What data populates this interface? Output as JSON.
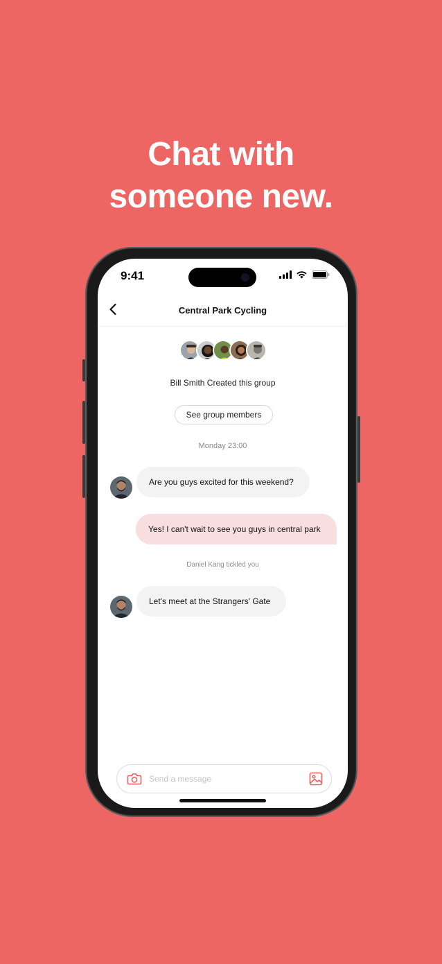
{
  "promo": {
    "headline_line1": "Chat with",
    "headline_line2": "someone new."
  },
  "status_bar": {
    "time": "9:41"
  },
  "nav": {
    "title": "Central Park Cycling"
  },
  "group": {
    "created_text": "Bill Smith Created this group",
    "members_button": "See group members",
    "member_avatars": [
      "avatar-1",
      "avatar-2",
      "avatar-3",
      "avatar-4",
      "avatar-5"
    ]
  },
  "chat": {
    "day_label": "Monday 23:00",
    "messages": [
      {
        "direction": "incoming",
        "text": "Are you guys excited for this weekend?"
      },
      {
        "direction": "outgoing",
        "text": "Yes! I can't wait to see you guys in central park"
      }
    ],
    "system_note": "Daniel Kang tickled you",
    "messages_after": [
      {
        "direction": "incoming",
        "text": "Let's meet at the Strangers' Gate"
      }
    ]
  },
  "composer": {
    "placeholder": "Send a message"
  },
  "colors": {
    "background": "#EE6663",
    "accent": "#E85F5C",
    "outgoing_bubble": "#F8DEDE",
    "incoming_bubble": "#F3F3F3"
  }
}
